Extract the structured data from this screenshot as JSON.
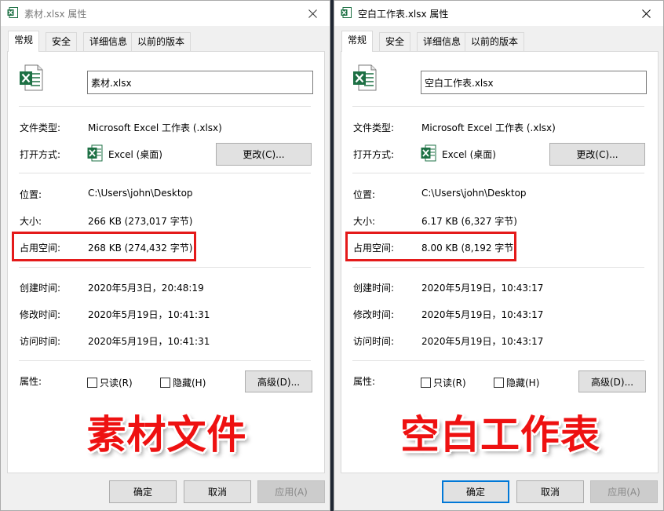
{
  "dialogs": [
    {
      "title": "素材.xlsx 属性",
      "tabs": [
        "常规",
        "安全",
        "详细信息",
        "以前的版本"
      ],
      "file_name": "素材.xlsx",
      "props": {
        "type_label": "文件类型:",
        "type_value": "Microsoft Excel 工作表 (.xlsx)",
        "openwith_label": "打开方式:",
        "openwith_value": "Excel (桌面)",
        "change_button": "更改(C)...",
        "location_label": "位置:",
        "location_value": "C:\\Users\\john\\Desktop",
        "size_label": "大小:",
        "size_value": "266 KB (273,017 字节)",
        "disk_size_label": "占用空间:",
        "disk_size_value": "268 KB (274,432 字节)",
        "created_label": "创建时间:",
        "created_value": "2020年5月3日，20:48:19",
        "modified_label": "修改时间:",
        "modified_value": "2020年5月19日，10:41:31",
        "accessed_label": "访问时间:",
        "accessed_value": "2020年5月19日，10:41:31",
        "attributes_label": "属性:",
        "readonly_label": "只读(R)",
        "hidden_label": "隐藏(H)",
        "advanced_button": "高级(D)..."
      },
      "caption": "素材文件",
      "buttons": {
        "ok": "确定",
        "cancel": "取消",
        "apply": "应用(A)"
      }
    },
    {
      "title": "空白工作表.xlsx 属性",
      "tabs": [
        "常规",
        "安全",
        "详细信息",
        "以前的版本"
      ],
      "file_name": "空白工作表.xlsx",
      "props": {
        "type_label": "文件类型:",
        "type_value": "Microsoft Excel 工作表 (.xlsx)",
        "openwith_label": "打开方式:",
        "openwith_value": "Excel (桌面)",
        "change_button": "更改(C)...",
        "location_label": "位置:",
        "location_value": "C:\\Users\\john\\Desktop",
        "size_label": "大小:",
        "size_value": "6.17 KB (6,327 字节)",
        "disk_size_label": "占用空间:",
        "disk_size_value": "8.00 KB (8,192 字节)",
        "created_label": "创建时间:",
        "created_value": "2020年5月19日，10:43:17",
        "modified_label": "修改时间:",
        "modified_value": "2020年5月19日，10:43:17",
        "accessed_label": "访问时间:",
        "accessed_value": "2020年5月19日，10:43:17",
        "attributes_label": "属性:",
        "readonly_label": "只读(R)",
        "hidden_label": "隐藏(H)",
        "advanced_button": "高级(D)..."
      },
      "caption": "空白工作表",
      "buttons": {
        "ok": "确定",
        "cancel": "取消",
        "apply": "应用(A)"
      }
    }
  ],
  "icons": {
    "title_icon": "excel-file-icon",
    "file_icon": "excel-file-icon",
    "openwith_icon": "excel-app-icon",
    "close_icon": "close-icon"
  },
  "colors": {
    "highlight": "#e41a1a",
    "caption": "#ee1111",
    "excel_green": "#1d7044",
    "primary_border": "#0078d7"
  }
}
